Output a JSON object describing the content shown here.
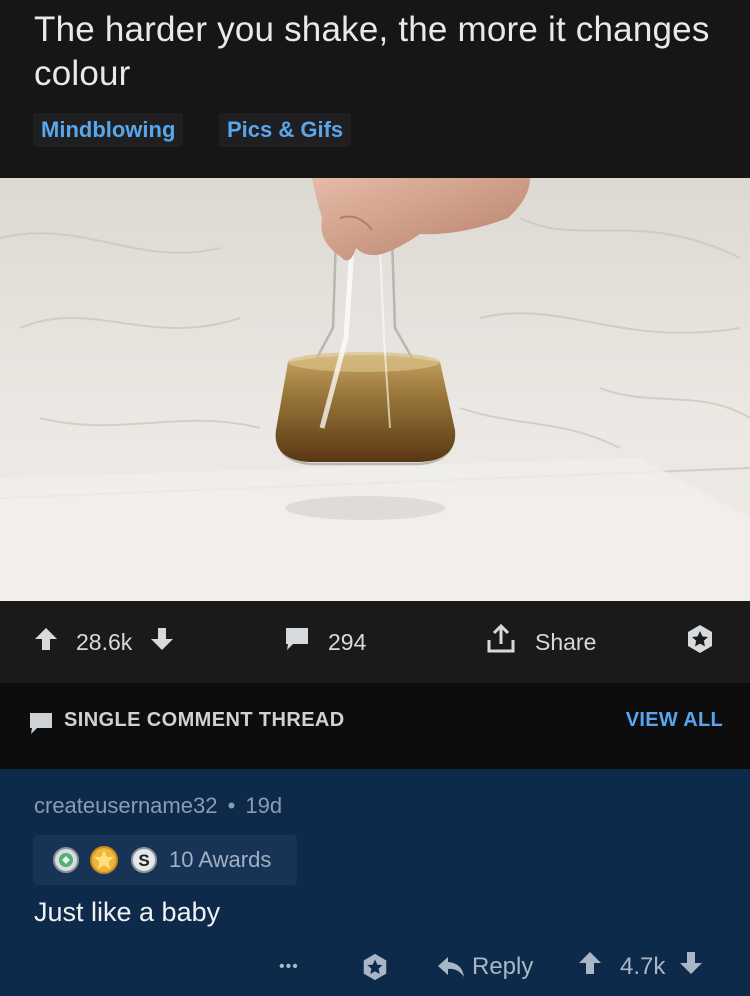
{
  "post": {
    "title": "The harder you shake, the more it changes colour",
    "flairs": [
      "Mindblowing",
      "Pics & Gifs"
    ]
  },
  "actions": {
    "upvotes": "28.6k",
    "comments": "294",
    "share_label": "Share"
  },
  "thread": {
    "label": "SINGLE COMMENT THREAD",
    "view_all_label": "VIEW ALL"
  },
  "comment": {
    "username": "createusername32",
    "separator": "•",
    "age": "19d",
    "awards_label": "10 Awards",
    "body": "Just like a baby",
    "more_label": "•••",
    "reply_label": "Reply",
    "score": "4.7k"
  },
  "colors": {
    "background": "#161616",
    "flair_text": "#5aa6ea",
    "link_blue": "#58a6f0",
    "comment_bg": "#0e2a4b"
  },
  "icons": [
    "upvote-icon",
    "downvote-icon",
    "comment-icon",
    "share-icon",
    "award-icon",
    "chat-icon",
    "reply-icon",
    "more-icon"
  ]
}
